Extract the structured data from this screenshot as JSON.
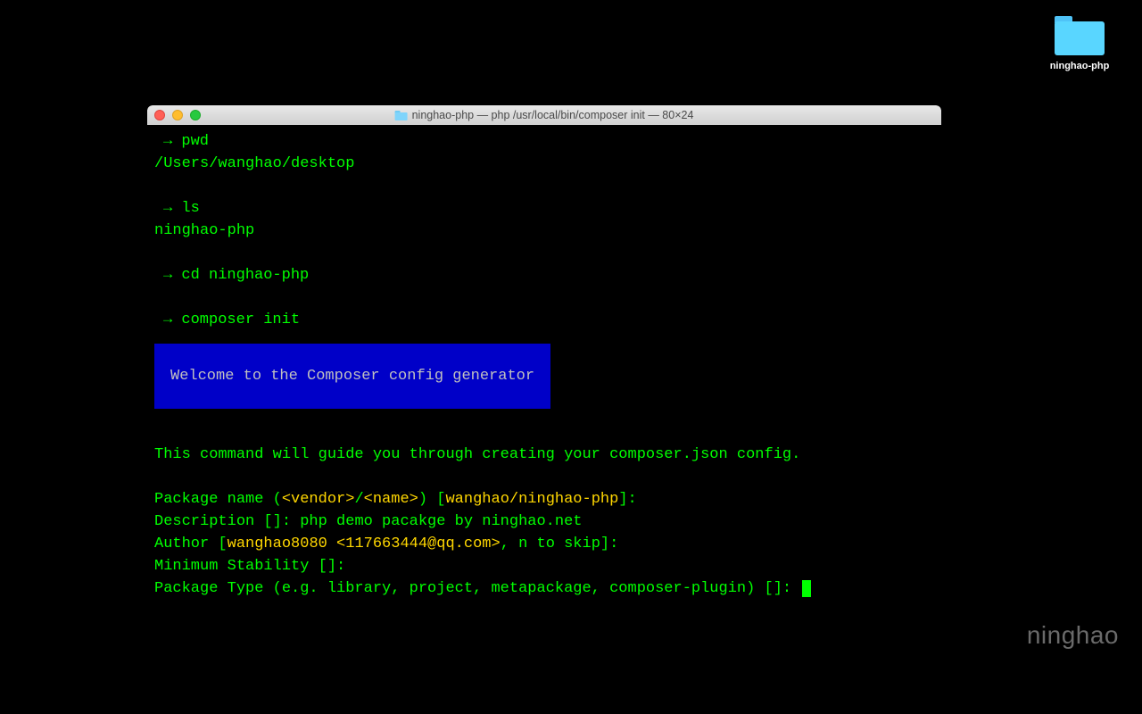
{
  "desktop": {
    "folder_name": "ninghao-php"
  },
  "terminal": {
    "title": "ninghao-php — php /usr/local/bin/composer init — 80×24",
    "lines": {
      "cmd1_arrow": "→",
      "cmd1": "pwd",
      "out1": "/Users/wanghao/desktop",
      "cmd2_arrow": "→",
      "cmd2": "ls",
      "out2": "ninghao-php",
      "cmd3_arrow": "→",
      "cmd3": "cd ninghao-php",
      "cmd4_arrow": "→",
      "cmd4": "composer init",
      "welcome": "Welcome to the Composer config generator",
      "guide": "This command will guide you through creating your composer.json config.",
      "pkg_prefix": "Package name (",
      "pkg_vendor": "<vendor>",
      "pkg_slash": "/",
      "pkg_name": "<name>",
      "pkg_suffix": ") [",
      "pkg_default": "wanghao/ninghao-php",
      "pkg_close": "]:",
      "desc_prefix": "Description []: ",
      "desc_value": "php demo pacakge by ninghao.net",
      "author_prefix": "Author [",
      "author_value": "wanghao8080 <117663444@qq.com>",
      "author_suffix": ", n to skip]:",
      "stability": "Minimum Stability []:",
      "pkgtype": "Package Type (e.g. library, project, metapackage, composer-plugin) []: "
    }
  },
  "watermark": "ninghao"
}
